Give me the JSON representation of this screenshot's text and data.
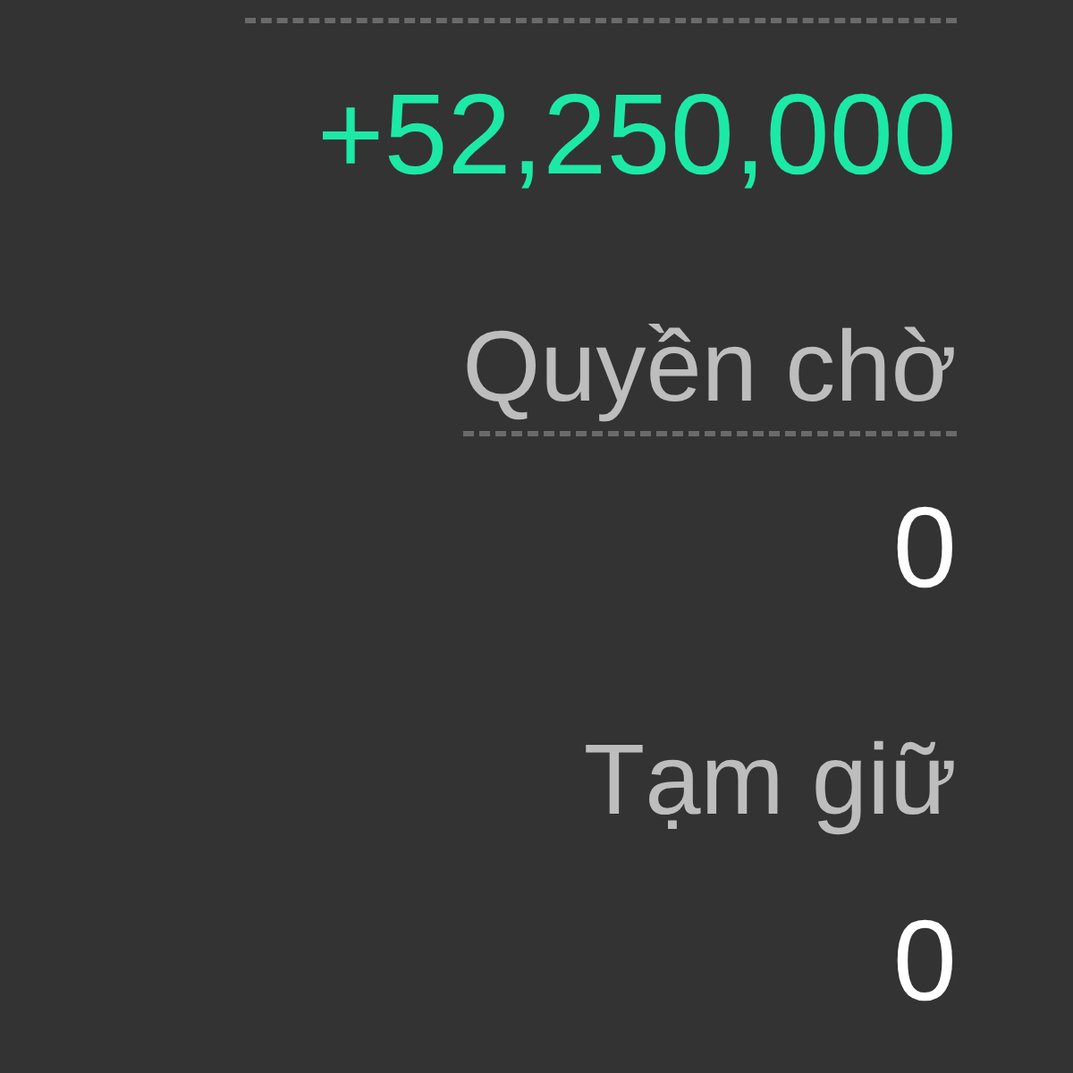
{
  "fields": [
    {
      "value": "+52,250,000",
      "kind": "positive",
      "hint": true
    },
    {
      "label": "Quyền chờ",
      "value": "0",
      "kind": "neutral",
      "hint": true
    },
    {
      "label": "Tạm giữ",
      "value": "0",
      "kind": "neutral",
      "hint": false
    }
  ]
}
